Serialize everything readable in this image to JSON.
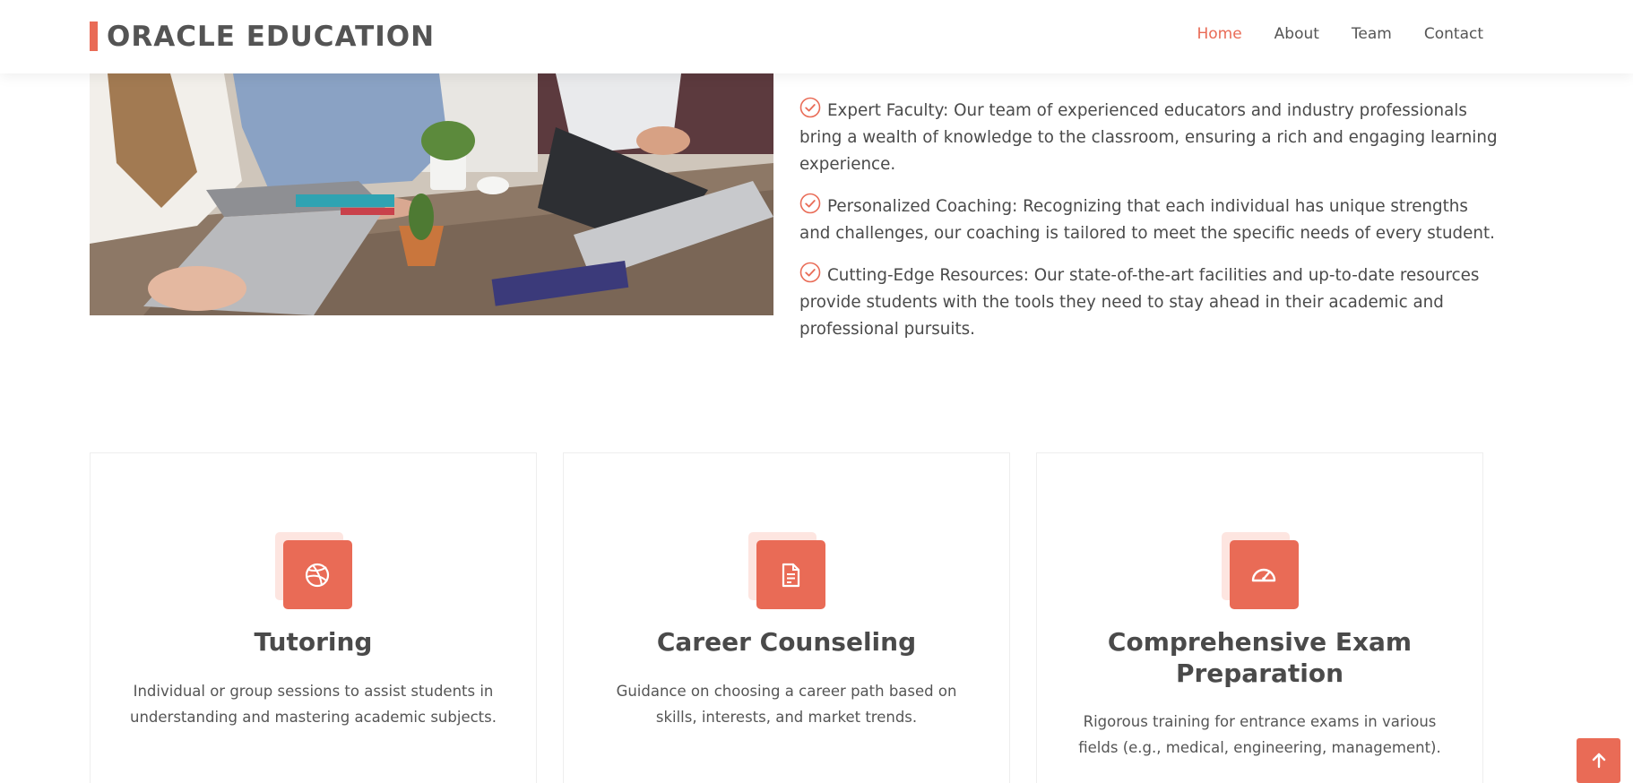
{
  "header": {
    "logo_text": "ORACLE EDUCATION",
    "nav": [
      {
        "label": "Home",
        "active": true
      },
      {
        "label": "About",
        "active": false
      },
      {
        "label": "Team",
        "active": false
      },
      {
        "label": "Contact",
        "active": false
      }
    ]
  },
  "about": {
    "image": "classroom-photo",
    "items": [
      {
        "icon": "check-circle-icon",
        "text": "Expert Faculty: Our team of experienced educators and industry professionals bring a wealth of knowledge to the classroom, ensuring a rich and engaging learning experience."
      },
      {
        "icon": "check-circle-icon",
        "text": "Personalized Coaching: Recognizing that each individual has unique strengths and challenges, our coaching is tailored to meet the specific needs of every student."
      },
      {
        "icon": "check-circle-icon",
        "text": "Cutting-Edge Resources: Our state-of-the-art facilities and up-to-date resources provide students with the tools they need to stay ahead in their academic and professional pursuits."
      }
    ]
  },
  "services": [
    {
      "icon": "dribbble-icon",
      "title": "Tutoring",
      "description": "Individual or group sessions to assist students in understanding and mastering academic subjects."
    },
    {
      "icon": "file-text-icon",
      "title": "Career Counseling",
      "description": "Guidance on choosing a career path based on skills, interests, and market trends."
    },
    {
      "icon": "speedometer-icon",
      "title": "Comprehensive Exam Preparation",
      "description": "Rigorous training for entrance exams in various fields (e.g., medical, engineering, management)."
    }
  ],
  "back_to_top": {
    "icon": "arrow-up-icon"
  },
  "colors": {
    "accent": "#e96b56",
    "accent_light": "#fde5e0",
    "text": "#444444"
  }
}
